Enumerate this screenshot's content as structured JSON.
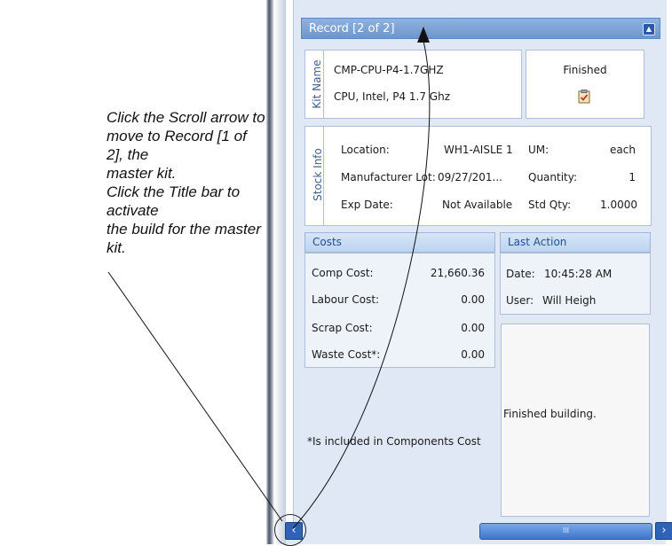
{
  "instruction": {
    "lines": [
      "Click the Scroll arrow to",
      "move to Record [1 of 2], the",
      "master kit.",
      "Click the Title bar to activate",
      "the build for the master kit."
    ]
  },
  "record": {
    "title": "Record [2 of 2]",
    "collapse_icon": "chevron-up-icon"
  },
  "kit_name": {
    "section_label": "Kit Name",
    "code": "CMP-CPU-P4-1.7GHZ",
    "description": "CPU, Intel, P4 1.7 Ghz",
    "status": "Finished",
    "status_icon": "clipboard-check-icon"
  },
  "stock_info": {
    "section_label": "Stock Info",
    "location_label": "Location:",
    "location_value": "WH1-AISLE 1",
    "um_label": "UM:",
    "um_value": "each",
    "lot_label": "Manufacturer Lot:",
    "lot_value": "09/27/201...",
    "quantity_label": "Quantity:",
    "quantity_value": "1",
    "exp_label": "Exp Date:",
    "exp_value": "Not Available",
    "std_qty_label": "Std Qty:",
    "std_qty_value": "1.0000"
  },
  "costs": {
    "header": "Costs",
    "rows": [
      {
        "label": "Comp Cost:",
        "value": "21,660.36"
      },
      {
        "label": "Labour Cost:",
        "value": "0.00"
      },
      {
        "label": "Scrap Cost:",
        "value": "0.00"
      },
      {
        "label": "Waste Cost*:",
        "value": "0.00"
      }
    ],
    "footnote": "*Is included in Components Cost"
  },
  "last_action": {
    "header": "Last Action",
    "date_label": "Date:",
    "date_value": "10:45:28 AM",
    "user_label": "User:",
    "user_value": "Will Heigh",
    "message": "Finished building."
  },
  "scrollbar": {
    "left_icon": "scroll-left-arrow-icon",
    "right_icon": "scroll-right-arrow-icon",
    "grip": "III"
  },
  "colors": {
    "title_bar": "#7a9fd3",
    "header_text": "#1f4f8f",
    "scroll_button": "#2f63b8"
  }
}
